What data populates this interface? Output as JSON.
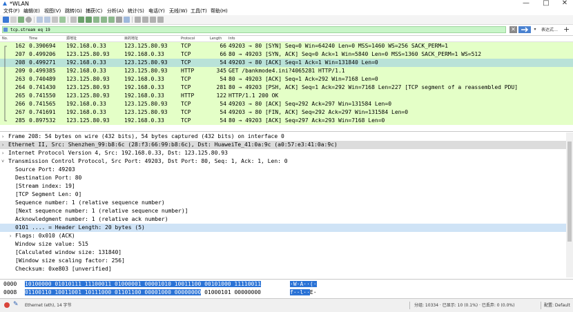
{
  "window": {
    "title": "*WLAN",
    "controls": {
      "minimize": "—",
      "maximize": "□",
      "close": "✕"
    }
  },
  "menu": [
    "文件(F)",
    "编辑(E)",
    "视图(V)",
    "跳转(G)",
    "捕获(C)",
    "分析(A)",
    "统计(S)",
    "电话(Y)",
    "无线(W)",
    "工具(T)",
    "帮助(H)"
  ],
  "filter": {
    "value": "tcp.stream eq 19",
    "clear": "✕",
    "dropdown": "▾",
    "expression_label": "表达式…",
    "add": "+"
  },
  "packet_columns": [
    "No.",
    "Time",
    "源地址",
    "目的地址",
    "Protocol",
    "Length",
    "Info"
  ],
  "packets": [
    {
      "no": "162",
      "time": "0.390694",
      "src": "192.168.0.33",
      "dst": "123.125.80.93",
      "proto": "TCP",
      "len": "66",
      "info": "49203 → 80 [SYN] Seq=0 Win=64240 Len=0 MSS=1460 WS=256 SACK_PERM=1",
      "selected": false
    },
    {
      "no": "207",
      "time": "0.499206",
      "src": "123.125.80.93",
      "dst": "192.168.0.33",
      "proto": "TCP",
      "len": "66",
      "info": "80 → 49203 [SYN, ACK] Seq=0 Ack=1 Win=5840 Len=0 MSS=1360 SACK_PERM=1 WS=512",
      "selected": false
    },
    {
      "no": "208",
      "time": "0.499271",
      "src": "192.168.0.33",
      "dst": "123.125.80.93",
      "proto": "TCP",
      "len": "54",
      "info": "49203 → 80 [ACK] Seq=1 Ack=1 Win=131840 Len=0",
      "selected": true
    },
    {
      "no": "209",
      "time": "0.499385",
      "src": "192.168.0.33",
      "dst": "123.125.80.93",
      "proto": "HTTP",
      "len": "345",
      "info": "GET /bankmode4.ini?4065281 HTTP/1.1",
      "selected": false
    },
    {
      "no": "263",
      "time": "0.740489",
      "src": "123.125.80.93",
      "dst": "192.168.0.33",
      "proto": "TCP",
      "len": "54",
      "info": "80 → 49203 [ACK] Seq=1 Ack=292 Win=7168 Len=0",
      "selected": false
    },
    {
      "no": "264",
      "time": "0.741430",
      "src": "123.125.80.93",
      "dst": "192.168.0.33",
      "proto": "TCP",
      "len": "281",
      "info": "80 → 49203 [PSH, ACK] Seq=1 Ack=292 Win=7168 Len=227 [TCP segment of a reassembled PDU]",
      "selected": false
    },
    {
      "no": "265",
      "time": "0.741550",
      "src": "123.125.80.93",
      "dst": "192.168.0.33",
      "proto": "HTTP",
      "len": "122",
      "info": "HTTP/1.1 200 OK",
      "selected": false
    },
    {
      "no": "266",
      "time": "0.741565",
      "src": "192.168.0.33",
      "dst": "123.125.80.93",
      "proto": "TCP",
      "len": "54",
      "info": "49203 → 80 [ACK] Seq=292 Ack=297 Win=131584 Len=0",
      "selected": false
    },
    {
      "no": "267",
      "time": "0.741691",
      "src": "192.168.0.33",
      "dst": "123.125.80.93",
      "proto": "TCP",
      "len": "54",
      "info": "49203 → 80 [FIN, ACK] Seq=292 Ack=297 Win=131584 Len=0",
      "selected": false
    },
    {
      "no": "285",
      "time": "0.897532",
      "src": "123.125.80.93",
      "dst": "192.168.0.33",
      "proto": "TCP",
      "len": "54",
      "info": "80 → 49203 [ACK] Seq=297 Ack=293 Win=7168 Len=0",
      "selected": false
    }
  ],
  "details": [
    {
      "arrow": "›",
      "indent": 0,
      "text": "Frame 208: 54 bytes on wire (432 bits), 54 bytes captured (432 bits) on interface 0",
      "style": ""
    },
    {
      "arrow": "›",
      "indent": 0,
      "text": "Ethernet II, Src: Shenzhen_99:b8:6c (28:f3:66:99:b8:6c), Dst: HuaweiTe_41:0a:9c (a0:57:e3:41:0a:9c)",
      "style": "hl"
    },
    {
      "arrow": "›",
      "indent": 0,
      "text": "Internet Protocol Version 4, Src: 192.168.0.33, Dst: 123.125.80.93",
      "style": ""
    },
    {
      "arrow": "˅",
      "indent": 0,
      "text": "Transmission Control Protocol, Src Port: 49203, Dst Port: 80, Seq: 1, Ack: 1, Len: 0",
      "style": ""
    },
    {
      "arrow": "",
      "indent": 1,
      "text": "Source Port: 49203",
      "style": ""
    },
    {
      "arrow": "",
      "indent": 1,
      "text": "Destination Port: 80",
      "style": ""
    },
    {
      "arrow": "",
      "indent": 1,
      "text": "[Stream index: 19]",
      "style": ""
    },
    {
      "arrow": "",
      "indent": 1,
      "text": "[TCP Segment Len: 0]",
      "style": ""
    },
    {
      "arrow": "",
      "indent": 1,
      "text": "Sequence number: 1    (relative sequence number)",
      "style": ""
    },
    {
      "arrow": "",
      "indent": 1,
      "text": "[Next sequence number: 1    (relative sequence number)]",
      "style": ""
    },
    {
      "arrow": "",
      "indent": 1,
      "text": "Acknowledgment number: 1    (relative ack number)",
      "style": ""
    },
    {
      "arrow": "",
      "indent": 1,
      "text": "0101 .... = Header Length: 20 bytes (5)",
      "style": "sel"
    },
    {
      "arrow": "›",
      "indent": 1,
      "text": "Flags: 0x010 (ACK)",
      "style": ""
    },
    {
      "arrow": "",
      "indent": 1,
      "text": "Window size value: 515",
      "style": ""
    },
    {
      "arrow": "",
      "indent": 1,
      "text": "[Calculated window size: 131840]",
      "style": ""
    },
    {
      "arrow": "",
      "indent": 1,
      "text": "[Window size scaling factor: 256]",
      "style": ""
    },
    {
      "arrow": "",
      "indent": 1,
      "text": "Checksum: 0xe803 [unverified]",
      "style": ""
    }
  ],
  "bytes": [
    {
      "offset": "0000",
      "bits_sel": "10100000 01010111 11100011 01000001 00001010 10011100 00101000 11110011",
      "bits_rest": "",
      "ascii_sel": "·W·A··(·",
      "ascii_rest": ""
    },
    {
      "offset": "0008",
      "bits_sel": "01100110 10011001 10111000 01101100 00001000 00000000",
      "bits_rest": " 01000101 00000000",
      "ascii_sel": "f··l··",
      "ascii_rest": "E·"
    }
  ],
  "status": {
    "field": "Ethernet (eth), 14 字节",
    "stats": "分组: 10334 · 已显示: 10 (0.1%) · 已丢弃: 0 (0.0%)",
    "profile": "配置: Default"
  },
  "colors": {
    "tcp_row": "#e4ffc7",
    "selected_row": "#b9e2d8",
    "filter_ok": "#c8f5c8",
    "byte_highlight": "#2b73d6"
  }
}
